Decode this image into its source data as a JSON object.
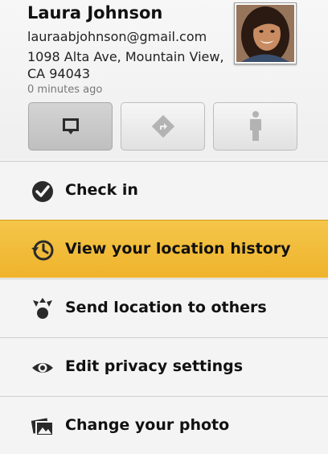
{
  "contact": {
    "name": "Laura Johnson",
    "email": "lauraabjohnson@gmail.com",
    "address": "1098 Alta Ave, Mountain View, CA 94043",
    "updated": "0 minutes ago"
  },
  "actions": [
    {
      "icon": "map-pin-icon",
      "active": true
    },
    {
      "icon": "directions-icon",
      "active": false
    },
    {
      "icon": "person-icon",
      "active": false
    }
  ],
  "menu": [
    {
      "label": "Check in",
      "icon": "checkmark-icon",
      "highlighted": false
    },
    {
      "label": "View your location history",
      "icon": "history-clock-icon",
      "highlighted": true
    },
    {
      "label": "Send location to others",
      "icon": "share-location-icon",
      "highlighted": false
    },
    {
      "label": "Edit privacy settings",
      "icon": "eye-icon",
      "highlighted": false
    },
    {
      "label": "Change your photo",
      "icon": "photo-icon",
      "highlighted": false
    }
  ],
  "colors": {
    "highlight": "#f0b72f",
    "background": "#f4f4f4"
  }
}
